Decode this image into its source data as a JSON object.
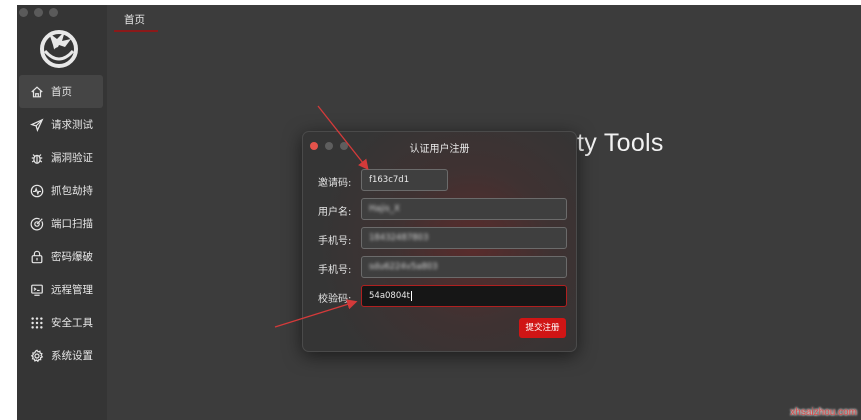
{
  "window": {
    "tab_title": "首页",
    "background_title": "ty Tools"
  },
  "sidebar": {
    "items": [
      {
        "label": "首页",
        "icon": "home-icon",
        "active": true
      },
      {
        "label": "请求测试",
        "icon": "send-icon",
        "active": false
      },
      {
        "label": "漏洞验证",
        "icon": "bug-icon",
        "active": false
      },
      {
        "label": "抓包劫持",
        "icon": "pulse-icon",
        "active": false
      },
      {
        "label": "端口扫描",
        "icon": "radar-icon",
        "active": false
      },
      {
        "label": "密码爆破",
        "icon": "lock-icon",
        "active": false
      },
      {
        "label": "远程管理",
        "icon": "terminal-icon",
        "active": false
      },
      {
        "label": "安全工具",
        "icon": "grid-icon",
        "active": false
      },
      {
        "label": "系统设置",
        "icon": "gear-icon",
        "active": false
      }
    ]
  },
  "dialog": {
    "title": "认证用户注册",
    "fields": {
      "invite": {
        "label": "邀请码:",
        "value": "f163c7d1"
      },
      "username": {
        "label": "用户名:",
        "value": "Hajis_X"
      },
      "phone1": {
        "label": "手机号:",
        "value": "18432487803"
      },
      "phone2": {
        "label": "手机号:",
        "value": "sdu6224v5a803"
      },
      "verify": {
        "label": "校验码:",
        "value": "54a0804t"
      }
    },
    "submit_label": "提交注册"
  },
  "watermark": "xhsaizhou.com",
  "colors": {
    "accent": "#d01515",
    "sidebar_bg": "#353535",
    "main_bg": "#3c3c3c"
  }
}
